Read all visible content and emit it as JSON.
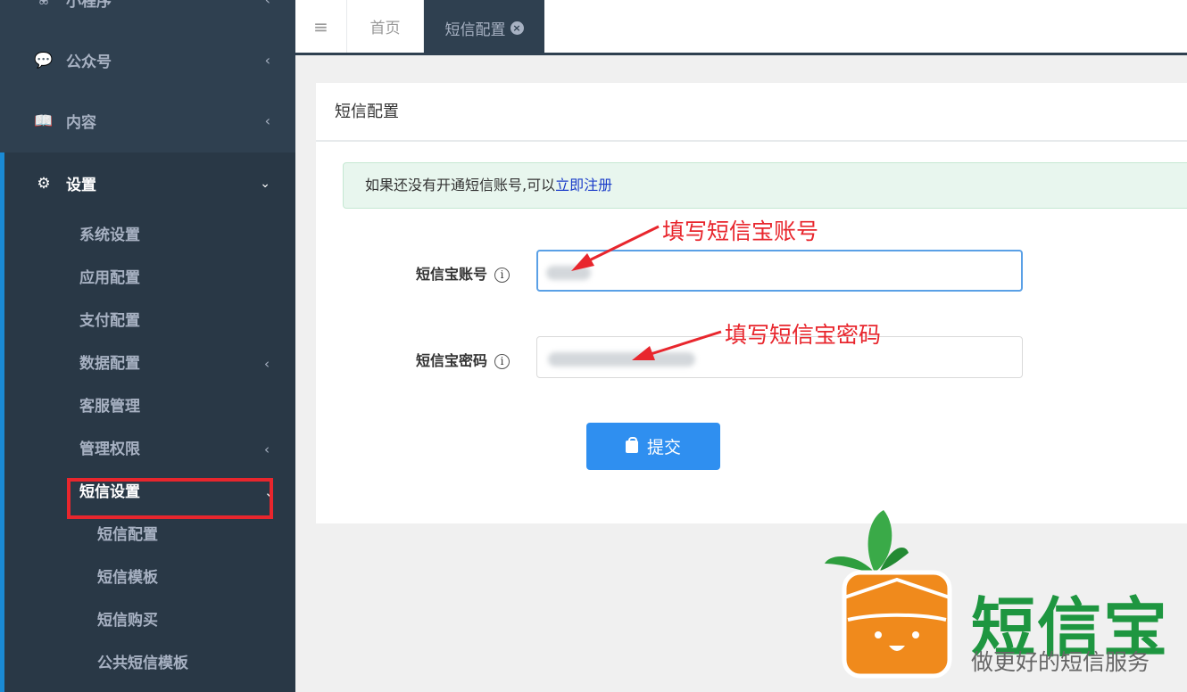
{
  "sidebar": {
    "top_items": [
      {
        "label": "小程序",
        "icon": "wechat-miniprogram-icon"
      },
      {
        "label": "公众号",
        "icon": "wechat-icon"
      },
      {
        "label": "内容",
        "icon": "book-icon"
      }
    ],
    "settings": {
      "label": "设置",
      "icon": "gear-icon",
      "items": [
        {
          "label": "系统设置"
        },
        {
          "label": "应用配置"
        },
        {
          "label": "支付配置"
        },
        {
          "label": "数据配置"
        },
        {
          "label": "客服管理"
        },
        {
          "label": "管理权限"
        },
        {
          "label": "短信设置"
        }
      ],
      "sms_children": [
        {
          "label": "短信配置"
        },
        {
          "label": "短信模板"
        },
        {
          "label": "短信购买"
        },
        {
          "label": "公共短信模板"
        }
      ]
    }
  },
  "tabs": {
    "home": "首页",
    "active": "短信配置"
  },
  "panel": {
    "title": "短信配置",
    "notice_text": "如果还没有开通短信账号,可以",
    "notice_link": "立即注册",
    "account_label": "短信宝账号",
    "password_label": "短信宝密码",
    "submit_label": "提交"
  },
  "annotations": {
    "account_hint": "填写短信宝账号",
    "password_hint": "填写短信宝密码"
  },
  "logo": {
    "title": "短信宝",
    "slogan": "做更好的短信服务"
  },
  "colors": {
    "sidebar_bg": "#2f4050",
    "accent_blue": "#2f8ff0",
    "annotation_red": "#e8262d",
    "logo_green": "#1e9640",
    "logo_orange": "#f08a1c"
  }
}
